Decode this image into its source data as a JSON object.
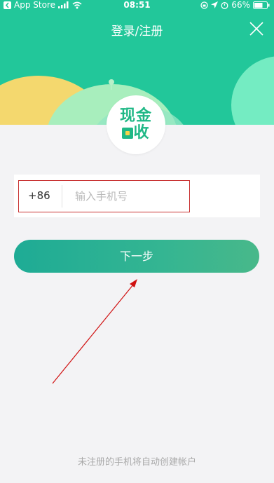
{
  "status_bar": {
    "back_app": "App Store",
    "time": "08:51",
    "battery": "66%"
  },
  "header": {
    "title": "登录/注册"
  },
  "logo": {
    "line1": "现金",
    "line2_char": "收"
  },
  "phone": {
    "country_code": "+86",
    "placeholder": "输入手机号",
    "value": ""
  },
  "next_button": {
    "label": "下一步"
  },
  "footer": {
    "note": "未注册的手机将自动创建帐户"
  },
  "colors": {
    "brand": "#22c79a",
    "highlight_border": "#c83232",
    "annotation_arrow": "#d01010"
  }
}
